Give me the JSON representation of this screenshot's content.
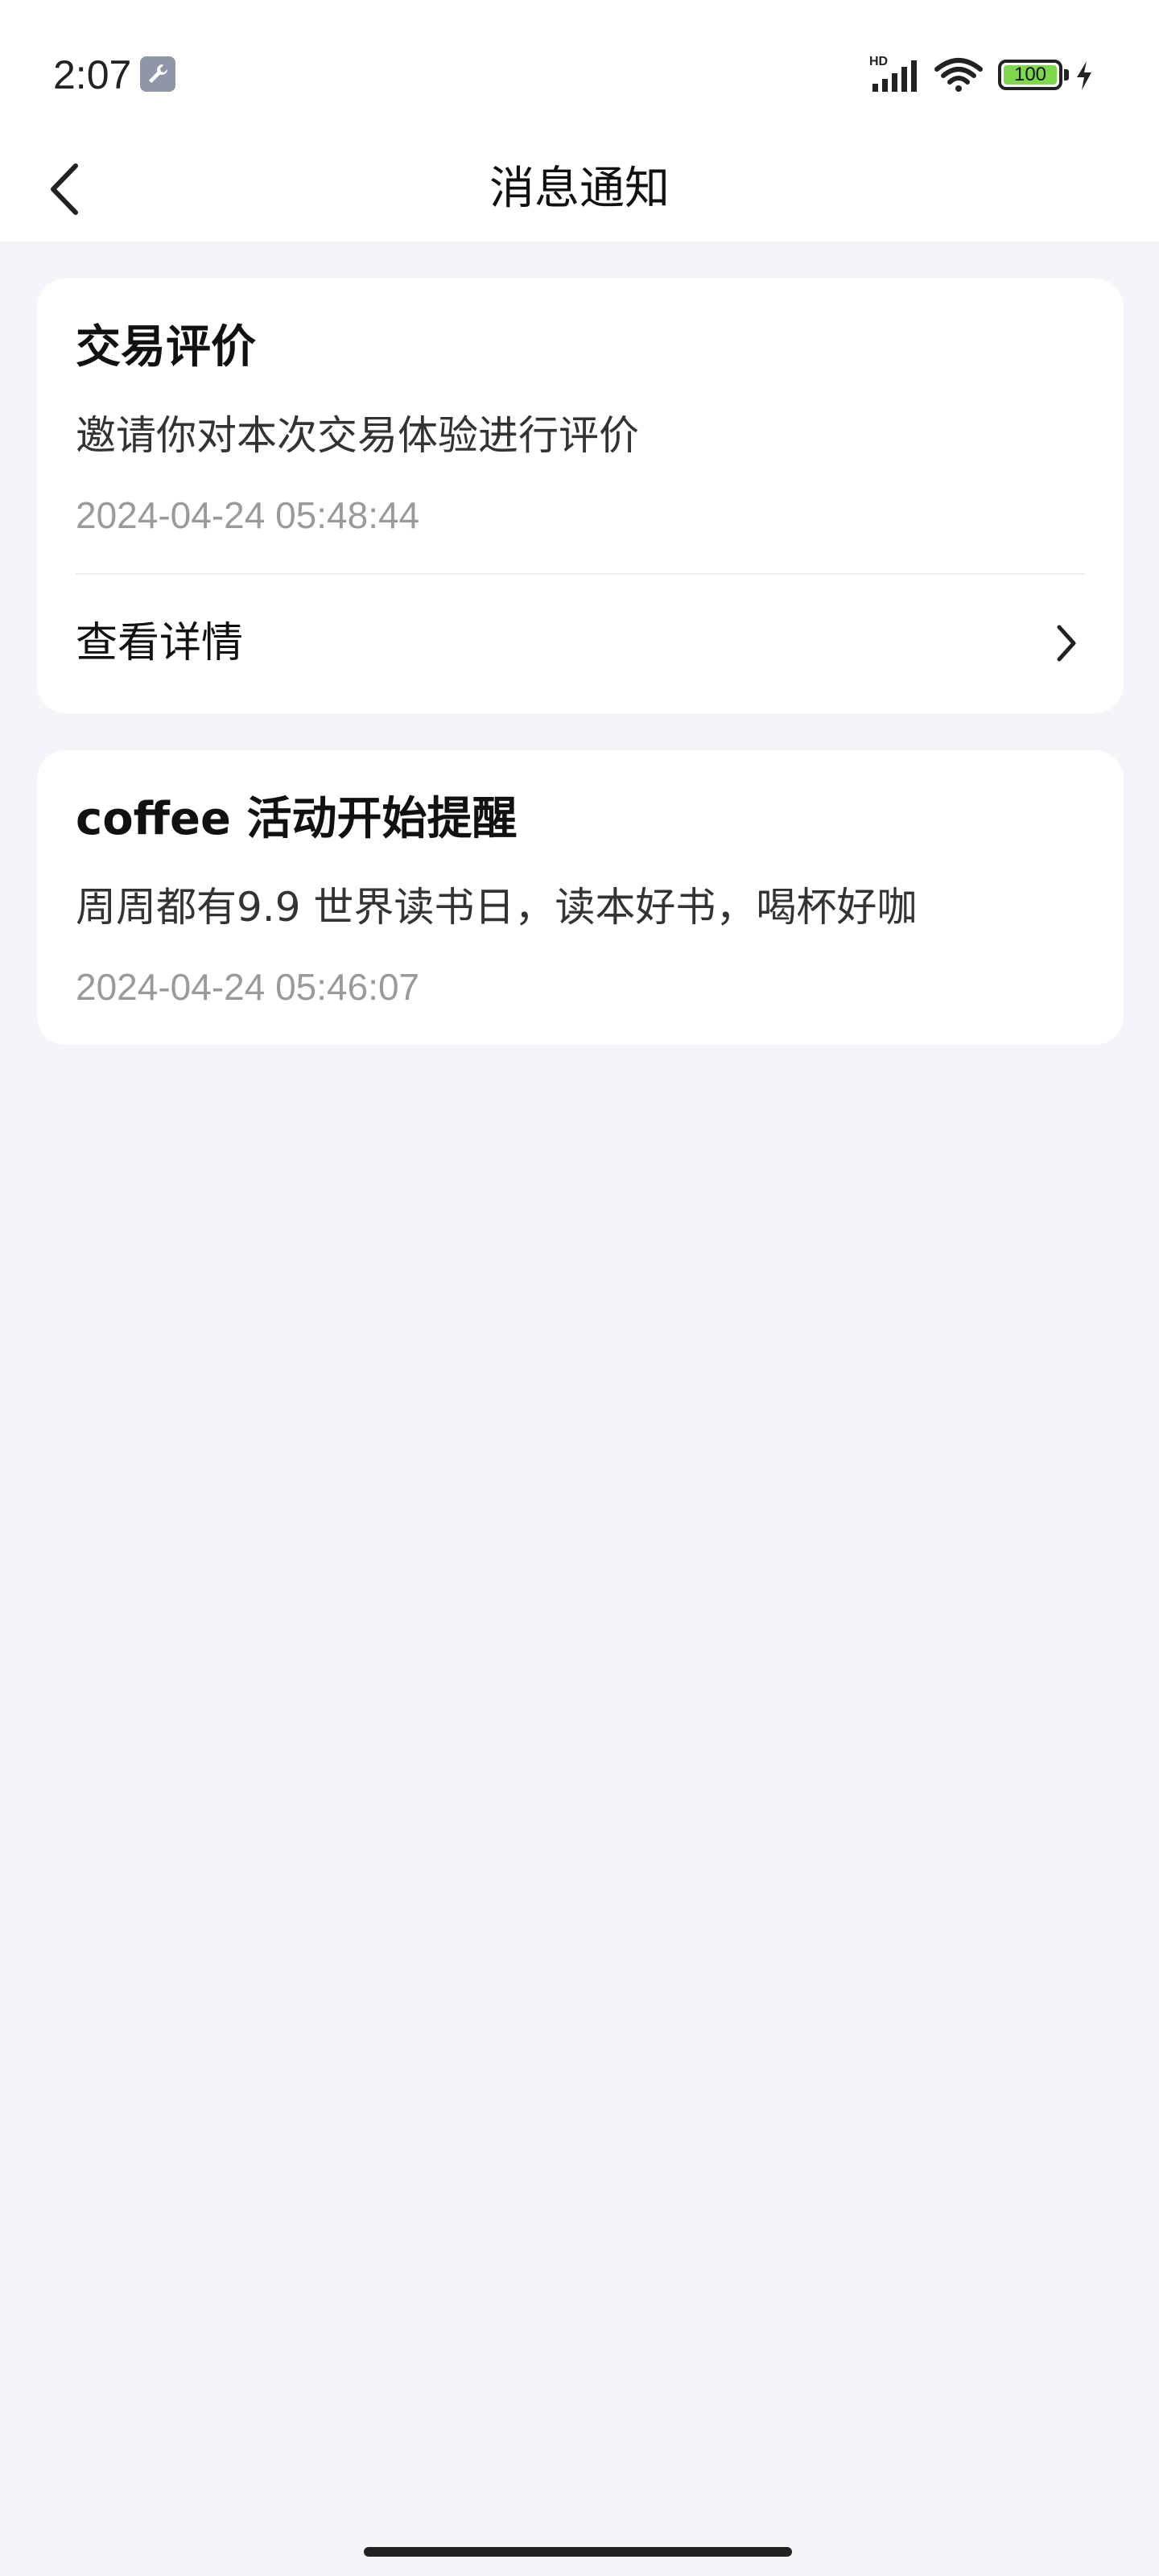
{
  "status_bar": {
    "time": "2:07",
    "hd_label": "HD",
    "battery_level": "100",
    "icons": [
      "wrench-icon",
      "signal-icon",
      "wifi-icon",
      "battery-icon",
      "charging-bolt-icon"
    ]
  },
  "header": {
    "title": "消息通知",
    "back_icon": "chevron-left-icon"
  },
  "notifications": [
    {
      "title": "交易评价",
      "description": "邀请你对本次交易体验进行评价",
      "time": "2024-04-24 05:48:44",
      "link_label": "查看详情",
      "link_icon": "chevron-right-icon"
    },
    {
      "title": "coffee 活动开始提醒",
      "description": "周周都有9.9 世界读书日，读本好书，喝杯好咖",
      "time": "2024-04-24 05:46:07"
    }
  ],
  "colors": {
    "background": "#f4f5f9",
    "card": "#ffffff",
    "battery_fill": "#7fd74c",
    "timestamp": "#9a9a9a"
  }
}
